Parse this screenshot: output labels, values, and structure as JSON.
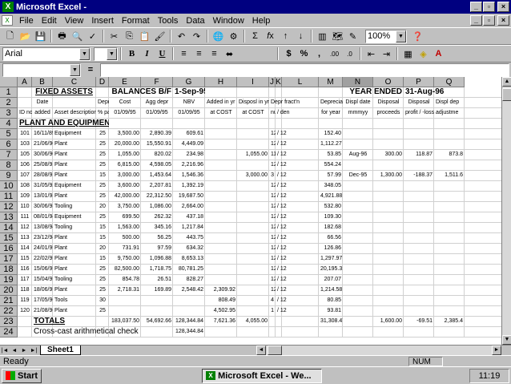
{
  "window": {
    "title": "Microsoft Excel -",
    "controls": {
      "minimize": "_",
      "restore": "▫",
      "close": "×"
    },
    "doc_controls": {
      "minimize": "_",
      "restore": "▫",
      "close": "×"
    }
  },
  "menu": [
    "File",
    "Edit",
    "View",
    "Insert",
    "Format",
    "Tools",
    "Data",
    "Window",
    "Help"
  ],
  "toolbar": {
    "zoom": "100%"
  },
  "format_toolbar": {
    "font": "Arial",
    "size": "",
    "bold": "B",
    "italic": "I",
    "underline": "U",
    "currency": "$",
    "percent": "%",
    "comma": ",",
    "inc_decimal": ".00",
    "dec_decimal": ".0"
  },
  "formula_bar": {
    "name_box": "",
    "equals": "=",
    "content": ""
  },
  "columns": [
    "A",
    "B",
    "C",
    "D",
    "E",
    "F",
    "G",
    "H",
    "I",
    "J",
    "K",
    "L",
    "M",
    "N",
    "O",
    "P",
    "Q"
  ],
  "selected_column": "N",
  "rows": [
    "1",
    "2",
    "3",
    "4",
    "5",
    "6",
    "7",
    "8",
    "9",
    "10",
    "11",
    "12",
    "13",
    "14",
    "15",
    "16",
    "17",
    "18",
    "19",
    "20",
    "21",
    "22",
    "23",
    "24"
  ],
  "sheet": {
    "title_fixed_assets": "FIXED ASSETS",
    "title_balances": "BALANCES B/F",
    "title_balances_date": "1-Sep-95",
    "title_year_ended": "YEAR ENDED",
    "title_year_ended_date": "31-Aug-96",
    "h2": {
      "date": "Date",
      "depr": "Depr",
      "cost": "Cost",
      "agg_depr": "Agg depr",
      "nbv": "NBV",
      "added": "Added in yr",
      "disposal_in_yr": "Disposl in yr",
      "depr_frac": "Depr fract'n",
      "depreciation": "Depreciation",
      "displ_date": "Displ date",
      "disposal": "Disposal",
      "disposal2": "Disposal",
      "displ_dep": "Displ dep"
    },
    "h3": {
      "id": "ID no.",
      "added": "added",
      "desc": "Asset description",
      "pct": "% pa",
      "cost_date": "01/09/95",
      "agg_date": "01/09/95",
      "nbv_date": "01/09/95",
      "at_cost": "at COST",
      "at_cost2": "at COST",
      "num": "num",
      "den": "/ den",
      "for_year": "for year",
      "mmmyy": "mmmyy",
      "proceeds": "proceeds",
      "profit_loss": "profit / -loss",
      "adjustment": "adjustme"
    },
    "section": "PLANT AND EQUIPMENT",
    "data_rows": [
      {
        "id": "101",
        "date": "16/11/89",
        "desc": "Equipment",
        "pct": "25",
        "cost": "3,500.00",
        "agg": "2,890.39",
        "nbv": "609.61",
        "added": "",
        "disposal": "",
        "num": "12",
        "den": "/ 12",
        "depr": "152.40",
        "ddate": "",
        "proceeds": "",
        "pl": "",
        "adj": ""
      },
      {
        "id": "103",
        "date": "21/06/90",
        "desc": "Plant",
        "pct": "25",
        "cost": "20,000.00",
        "agg": "15,550.91",
        "nbv": "4,449.09",
        "added": "",
        "disposal": "",
        "num": "12",
        "den": "/ 12",
        "depr": "1,112.27",
        "ddate": "",
        "proceeds": "",
        "pl": "",
        "adj": ""
      },
      {
        "id": "105",
        "date": "30/06/90",
        "desc": "Plant",
        "pct": "25",
        "cost": "1,055.00",
        "agg": "820.02",
        "nbv": "234.98",
        "added": "",
        "disposal": "1,055.00",
        "num": "11",
        "den": "/ 12",
        "depr": "53.85",
        "ddate": "Aug-96",
        "proceeds": "300.00",
        "pl": "118.87",
        "adj": "873.8"
      },
      {
        "id": "106",
        "date": "25/08/91",
        "desc": "Plant",
        "pct": "25",
        "cost": "6,815.00",
        "agg": "4,598.05",
        "nbv": "2,216.96",
        "added": "",
        "disposal": "",
        "num": "12",
        "den": "/ 12",
        "depr": "554.24",
        "ddate": "",
        "proceeds": "",
        "pl": "",
        "adj": ""
      },
      {
        "id": "107",
        "date": "28/08/91",
        "desc": "Plant",
        "pct": "15",
        "cost": "3,000.00",
        "agg": "1,453.64",
        "nbv": "1,546.36",
        "added": "",
        "disposal": "3,000.00",
        "num": "3",
        "den": "/ 12",
        "depr": "57.99",
        "ddate": "Dec-95",
        "proceeds": "1,300.00",
        "pl": "-188.37",
        "adj": "1,511.6"
      },
      {
        "id": "108",
        "date": "31/05/92",
        "desc": "Equipment",
        "pct": "25",
        "cost": "3,600.00",
        "agg": "2,207.81",
        "nbv": "1,392.19",
        "added": "",
        "disposal": "",
        "num": "12",
        "den": "/ 12",
        "depr": "348.05",
        "ddate": "",
        "proceeds": "",
        "pl": "",
        "adj": ""
      },
      {
        "id": "109",
        "date": "13/01/93",
        "desc": "Plant",
        "pct": "25",
        "cost": "42,000.00",
        "agg": "22,312.50",
        "nbv": "19,687.50",
        "added": "",
        "disposal": "",
        "num": "12",
        "den": "/ 12",
        "depr": "4,921.88",
        "ddate": "",
        "proceeds": "",
        "pl": "",
        "adj": ""
      },
      {
        "id": "110",
        "date": "30/06/93",
        "desc": "Tooling",
        "pct": "20",
        "cost": "3,750.00",
        "agg": "1,086.00",
        "nbv": "2,664.00",
        "added": "",
        "disposal": "",
        "num": "12",
        "den": "/ 12",
        "depr": "532.80",
        "ddate": "",
        "proceeds": "",
        "pl": "",
        "adj": ""
      },
      {
        "id": "111",
        "date": "08/01/94",
        "desc": "Equipment",
        "pct": "25",
        "cost": "699.50",
        "agg": "262.32",
        "nbv": "437.18",
        "added": "",
        "disposal": "",
        "num": "12",
        "den": "/ 12",
        "depr": "109.30",
        "ddate": "",
        "proceeds": "",
        "pl": "",
        "adj": ""
      },
      {
        "id": "112",
        "date": "13/08/94",
        "desc": "Tooling",
        "pct": "15",
        "cost": "1,563.00",
        "agg": "345.16",
        "nbv": "1,217.84",
        "added": "",
        "disposal": "",
        "num": "12",
        "den": "/ 12",
        "depr": "182.68",
        "ddate": "",
        "proceeds": "",
        "pl": "",
        "adj": ""
      },
      {
        "id": "113",
        "date": "23/12/94",
        "desc": "Plant",
        "pct": "15",
        "cost": "500.00",
        "agg": "56.25",
        "nbv": "443.75",
        "added": "",
        "disposal": "",
        "num": "12",
        "den": "/ 12",
        "depr": "66.56",
        "ddate": "",
        "proceeds": "",
        "pl": "",
        "adj": ""
      },
      {
        "id": "114",
        "date": "24/01/95",
        "desc": "Plant",
        "pct": "20",
        "cost": "731.91",
        "agg": "97.59",
        "nbv": "634.32",
        "added": "",
        "disposal": "",
        "num": "12",
        "den": "/ 12",
        "depr": "126.86",
        "ddate": "",
        "proceeds": "",
        "pl": "",
        "adj": ""
      },
      {
        "id": "115",
        "date": "22/02/95",
        "desc": "Plant",
        "pct": "15",
        "cost": "9,750.00",
        "agg": "1,096.88",
        "nbv": "8,653.13",
        "added": "",
        "disposal": "",
        "num": "12",
        "den": "/ 12",
        "depr": "1,297.97",
        "ddate": "",
        "proceeds": "",
        "pl": "",
        "adj": ""
      },
      {
        "id": "116",
        "date": "15/06/95",
        "desc": "Plant",
        "pct": "25",
        "cost": "82,500.00",
        "agg": "1,718.75",
        "nbv": "80,781.25",
        "added": "",
        "disposal": "",
        "num": "12",
        "den": "/ 12",
        "depr": "20,195.31",
        "ddate": "",
        "proceeds": "",
        "pl": "",
        "adj": ""
      },
      {
        "id": "117",
        "date": "15/04/95",
        "desc": "Tooling",
        "pct": "25",
        "cost": "854.78",
        "agg": "26.51",
        "nbv": "828.27",
        "added": "",
        "disposal": "",
        "num": "12",
        "den": "/ 12",
        "depr": "207.07",
        "ddate": "",
        "proceeds": "",
        "pl": "",
        "adj": ""
      },
      {
        "id": "118",
        "date": "18/06/95",
        "desc": "Plant",
        "pct": "25",
        "cost": "2,718.31",
        "agg": "169.89",
        "nbv": "2,548.42",
        "added": "2,309.92",
        "disposal": "",
        "num": "12",
        "den": "/ 12",
        "depr": "1,214.58",
        "ddate": "",
        "proceeds": "",
        "pl": "",
        "adj": ""
      },
      {
        "id": "119",
        "date": "17/05/96",
        "desc": "Tools",
        "pct": "30",
        "cost": "",
        "agg": "",
        "nbv": "",
        "added": "808.49",
        "disposal": "",
        "num": "4",
        "den": "/ 12",
        "depr": "80.85",
        "ddate": "",
        "proceeds": "",
        "pl": "",
        "adj": ""
      },
      {
        "id": "120",
        "date": "21/08/96",
        "desc": "Plant",
        "pct": "25",
        "cost": "",
        "agg": "",
        "nbv": "",
        "added": "4,502.95",
        "disposal": "",
        "num": "1",
        "den": "/ 12",
        "depr": "93.81",
        "ddate": "",
        "proceeds": "",
        "pl": "",
        "adj": ""
      }
    ],
    "totals": {
      "label": "TOTALS",
      "cost": "183,037.50",
      "agg": "54,692.66",
      "nbv": "128,344.84",
      "added": "7,621.36",
      "disposal": "4,055.00",
      "depr": "31,308.47",
      "proceeds": "1,600.00",
      "pl": "-69.51",
      "adj": "2,385.4"
    },
    "crosscast": {
      "label": "Cross-cast arithmetical check",
      "nbv": "128,344.84"
    }
  },
  "tabs": {
    "nav": [
      "|◄",
      "◄",
      "►",
      "►|"
    ],
    "sheet": "Sheet1"
  },
  "status": {
    "ready": "Ready",
    "num": "NUM"
  },
  "taskbar": {
    "start": "Start",
    "app": "Microsoft Excel - We...",
    "clock": "11:19"
  }
}
